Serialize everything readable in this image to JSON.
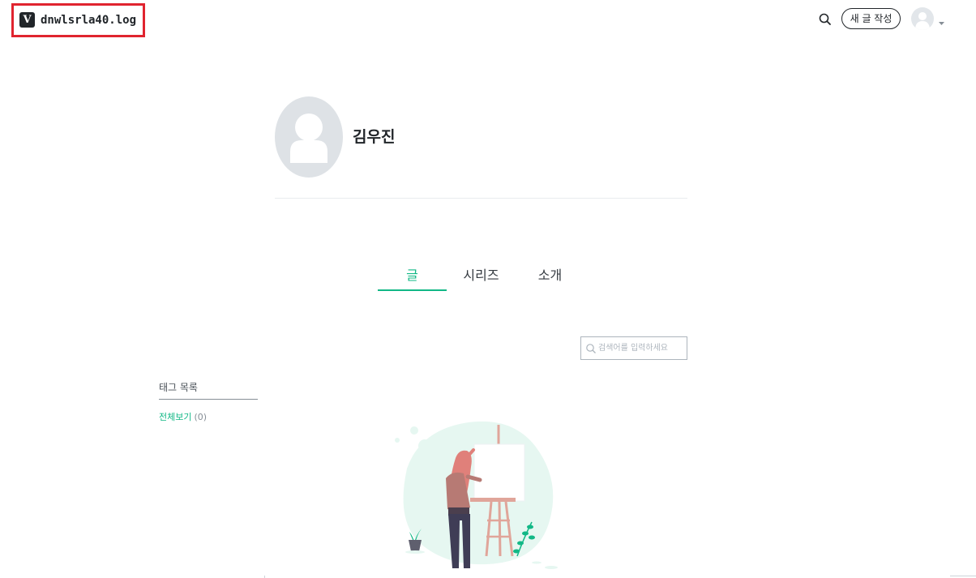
{
  "header": {
    "logo_letter": "V",
    "blog_title": "dnwlsrla40.log",
    "write_button_label": "새 글 작성",
    "icons": [
      "velog-logo-icon",
      "search-icon",
      "avatar-icon",
      "caret-down-icon"
    ]
  },
  "profile": {
    "name": "김우진"
  },
  "tabs": [
    {
      "label": "글",
      "active": true
    },
    {
      "label": "시리즈",
      "active": false
    },
    {
      "label": "소개",
      "active": false
    }
  ],
  "search": {
    "placeholder": "검색어를 입력하세요",
    "value": ""
  },
  "tags": {
    "title": "태그 목록",
    "all_label": "전체보기",
    "all_count": "(0)"
  },
  "colors": {
    "accent": "#12b886",
    "highlight_border": "#e0242f",
    "text": "#212529",
    "avatar_bg": "#dee2e6"
  }
}
